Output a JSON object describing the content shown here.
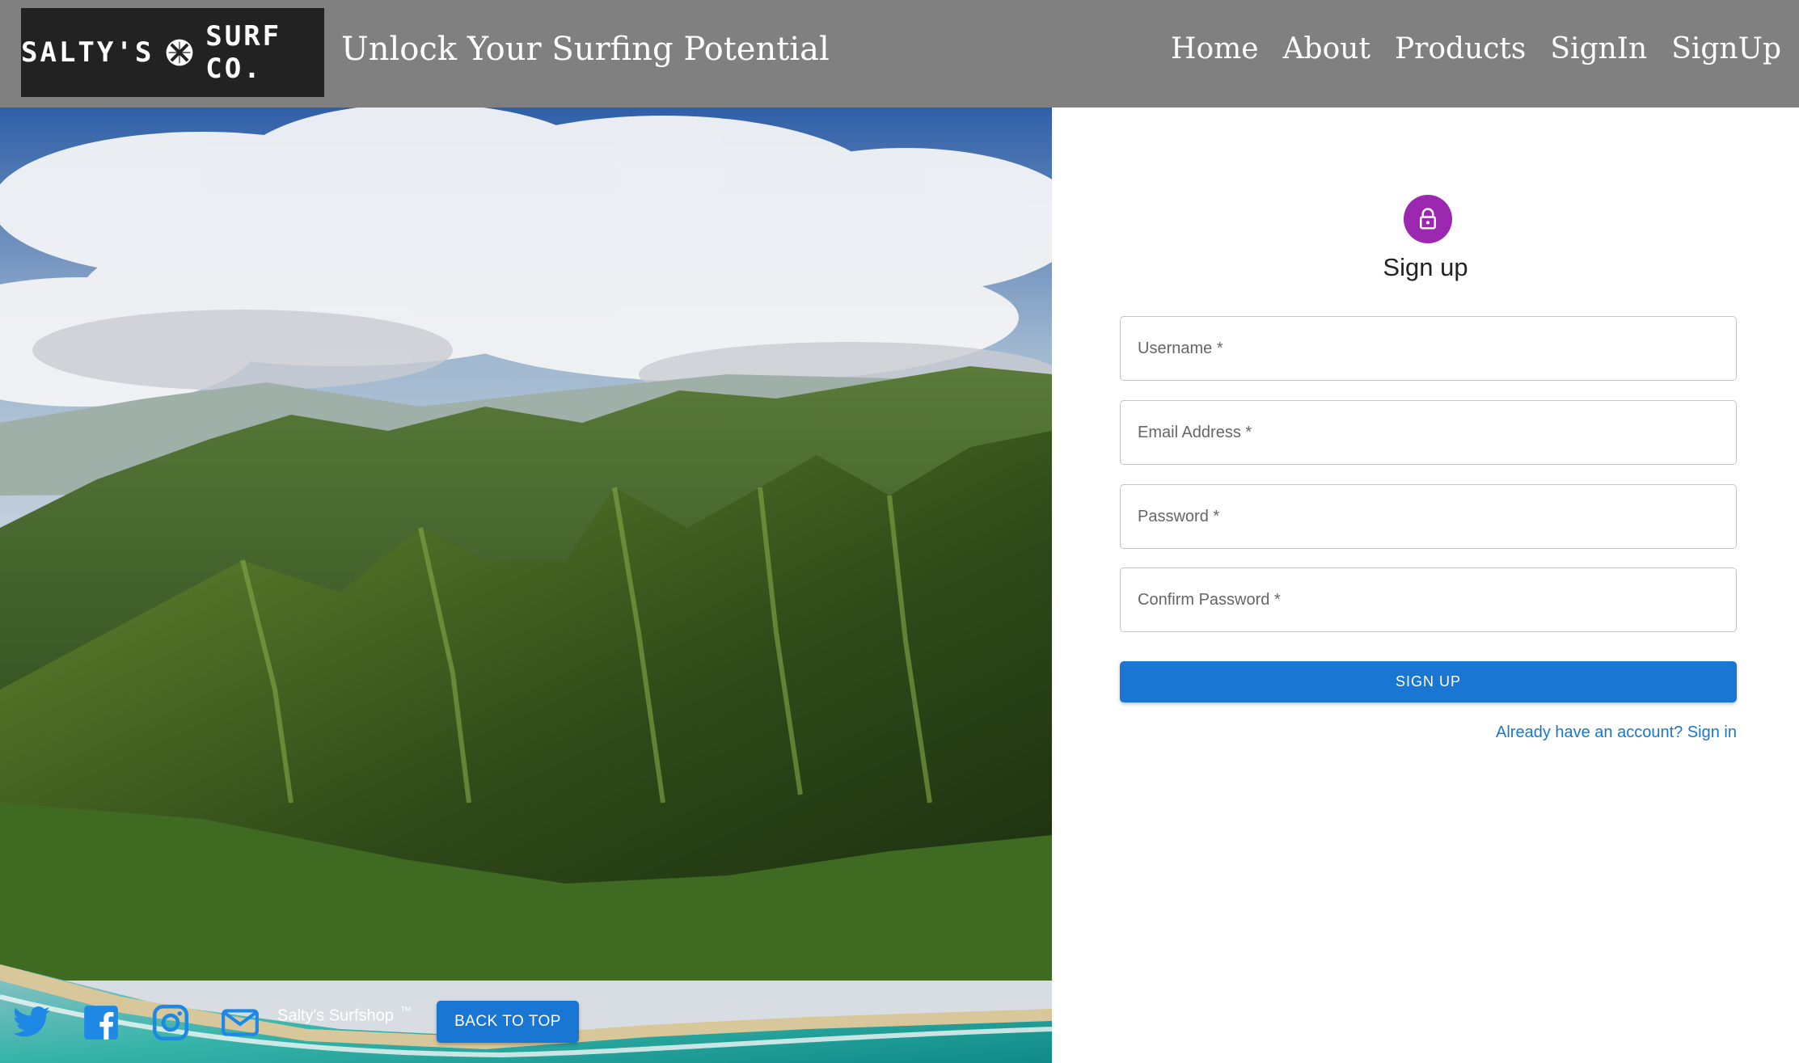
{
  "header": {
    "logo_left": "SALTY'S",
    "logo_right": "SURF CO.",
    "tagline": "Unlock Your Surfing Potential",
    "nav": [
      "Home",
      "About",
      "Products",
      "SignIn",
      "SignUp"
    ]
  },
  "footer": {
    "brand": "Salty's Surfshop",
    "trademark": "™",
    "back_to_top": "BACK TO TOP",
    "social_icons": [
      "twitter-icon",
      "facebook-icon",
      "instagram-icon",
      "mail-icon"
    ]
  },
  "form": {
    "title": "Sign up",
    "icon": "lock-icon",
    "fields": {
      "username": "Username *",
      "email": "Email Address *",
      "password": "Password *",
      "confirm": "Confirm Password *"
    },
    "submit": "SIGN UP",
    "signin_link": "Already have an account? Sign in"
  },
  "colors": {
    "header_bg": "#808080",
    "primary": "#1976d2",
    "avatar": "#9c27b0",
    "social": "#1e88e5"
  }
}
